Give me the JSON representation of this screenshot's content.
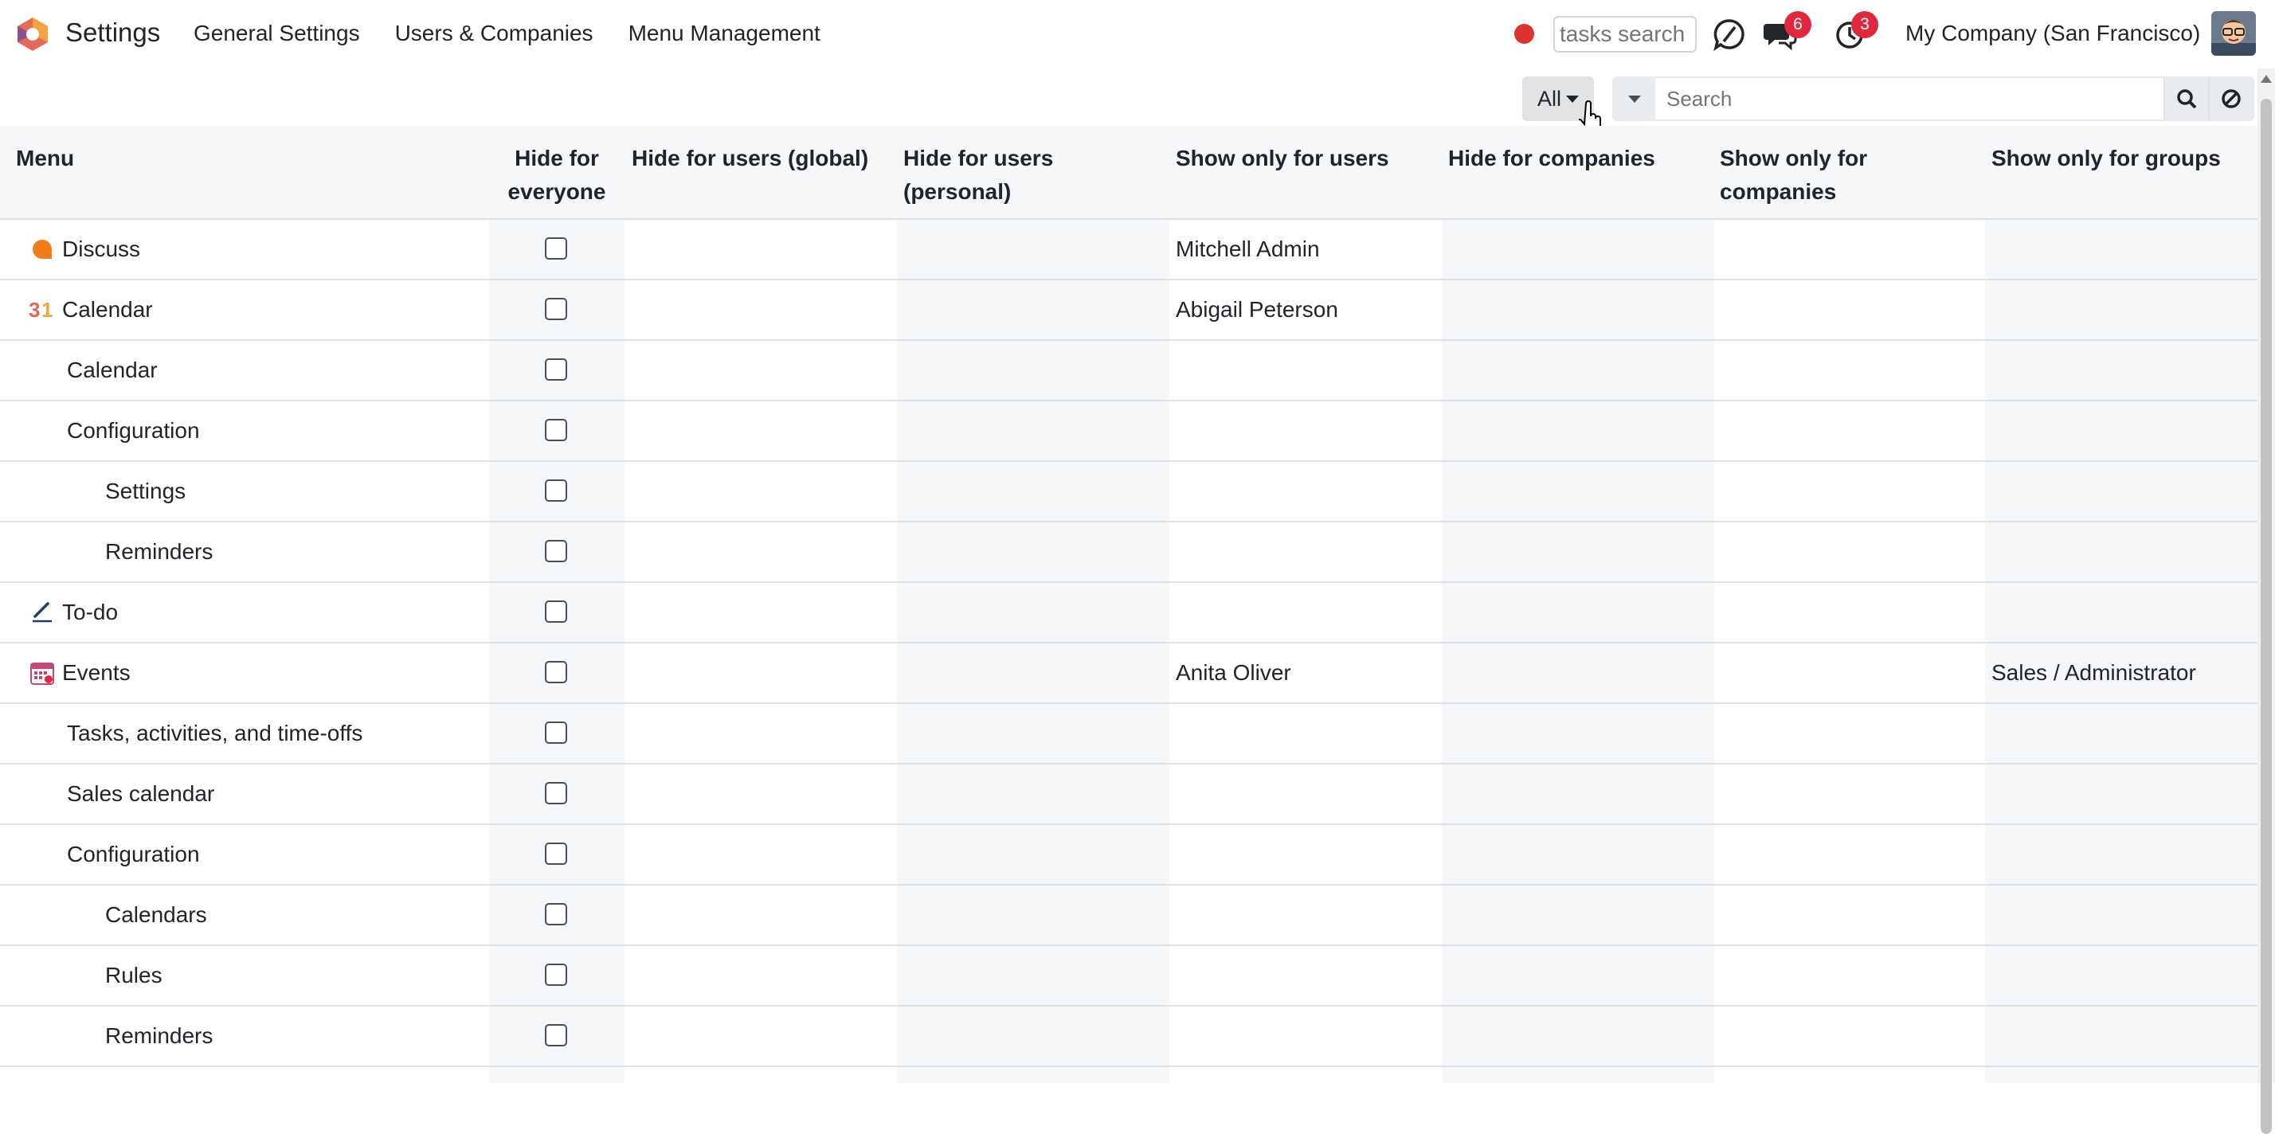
{
  "app": {
    "title": "Settings"
  },
  "nav": {
    "items": [
      {
        "label": "General Settings"
      },
      {
        "label": "Users & Companies"
      },
      {
        "label": "Menu Management"
      }
    ],
    "tasks_search_placeholder": "tasks search",
    "messages_badge": "6",
    "activities_badge": "3",
    "company": "My Company (San Francisco)"
  },
  "control": {
    "filter_label": "All",
    "search_placeholder": "Search"
  },
  "table": {
    "headers": {
      "menu": "Menu",
      "hide_everyone_1": "Hide for",
      "hide_everyone_2": "everyone",
      "hide_users_global": "Hide for users (global)",
      "hide_users_personal_1": "Hide for users",
      "hide_users_personal_2": "(personal)",
      "show_users": "Show only for users",
      "hide_companies": "Hide for companies",
      "show_companies_1": "Show only for",
      "show_companies_2": "companies",
      "show_groups": "Show only for groups"
    },
    "rows": [
      {
        "name": "Discuss",
        "level": 0,
        "icon": "discuss-icon",
        "show_users": "Mitchell Admin",
        "show_groups": ""
      },
      {
        "name": "Calendar",
        "level": 0,
        "icon": "calendar-app-icon",
        "show_users": "Abigail Peterson",
        "show_groups": ""
      },
      {
        "name": "Calendar",
        "level": 1,
        "icon": "",
        "show_users": "",
        "show_groups": ""
      },
      {
        "name": "Configuration",
        "level": 1,
        "icon": "",
        "show_users": "",
        "show_groups": ""
      },
      {
        "name": "Settings",
        "level": 2,
        "icon": "",
        "show_users": "",
        "show_groups": ""
      },
      {
        "name": "Reminders",
        "level": 2,
        "icon": "",
        "show_users": "",
        "show_groups": ""
      },
      {
        "name": "To-do",
        "level": 0,
        "icon": "todo-icon",
        "show_users": "",
        "show_groups": ""
      },
      {
        "name": "Events",
        "level": 0,
        "icon": "events-icon",
        "show_users": "Anita Oliver",
        "show_groups": "Sales / Administrator"
      },
      {
        "name": "Tasks, activities, and time-offs",
        "level": 1,
        "icon": "",
        "show_users": "",
        "show_groups": ""
      },
      {
        "name": "Sales calendar",
        "level": 1,
        "icon": "",
        "show_users": "",
        "show_groups": ""
      },
      {
        "name": "Configuration",
        "level": 1,
        "icon": "",
        "show_users": "",
        "show_groups": ""
      },
      {
        "name": "Calendars",
        "level": 2,
        "icon": "",
        "show_users": "",
        "show_groups": ""
      },
      {
        "name": "Rules",
        "level": 2,
        "icon": "",
        "show_users": "",
        "show_groups": ""
      },
      {
        "name": "Reminders",
        "level": 2,
        "icon": "",
        "show_users": "",
        "show_groups": ""
      },
      {
        "name": "",
        "level": 0,
        "icon": "",
        "show_users": "",
        "show_groups": ""
      }
    ]
  },
  "colors": {
    "accent_orange": "#f07d1a",
    "badge_red": "#e0293e",
    "record_red": "#dc3232",
    "shade": "#f6f7f9"
  }
}
